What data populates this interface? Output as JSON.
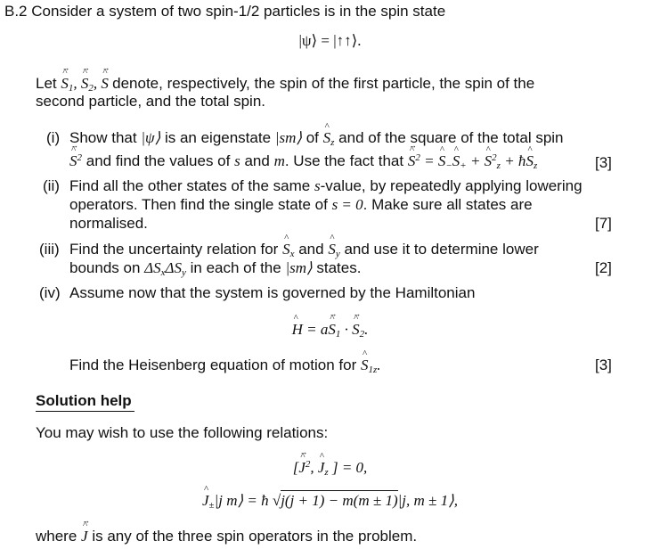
{
  "question": {
    "number": "B.2",
    "intro": "Consider a system of two spin-1/2 particles is in the spin state",
    "state_eq": "|ψ⟩ = |↑↑⟩.",
    "let_prefix": "Let",
    "let_ops": "S₁, S₂, S",
    "let_line1": "denote, respectively, the spin of the first particle, the spin of the",
    "let_line2": "second particle, and the total spin."
  },
  "parts": [
    {
      "label": "(i)",
      "line1_a": "Show that",
      "line1_psi": "|ψ⟩",
      "line1_b": "is an eigenstate",
      "line1_sm": "|sm⟩",
      "line1_c": "of",
      "line1_d": "and of the square of the total spin",
      "line2_a": "and find the values of",
      "line2_s": "s",
      "line2_and": "and",
      "line2_m": "m",
      "line2_b": ". Use the fact that",
      "line2_eq": "= S₋S₊ + S²_z + ħS_z",
      "marks": "[3]"
    },
    {
      "label": "(ii)",
      "line1_a": "Find all the other states of the same",
      "line1_s": "s",
      "line1_b": "-value, by repeatedly applying lowering",
      "line2_a": "operators.  Then find the single state of",
      "line2_eq": "s = 0",
      "line2_b": ".  Make sure all states are",
      "line3": "normalised.",
      "marks": "[7]"
    },
    {
      "label": "(iii)",
      "line1_a": "Find the uncertainty relation for",
      "line1_and": "and",
      "line1_b": "and use it to determine lower",
      "line2_a": "bounds on",
      "line2_eq": "ΔS_xΔS_y",
      "line2_b": "in each of the",
      "line2_sm": "|sm⟩",
      "line2_c": "states.",
      "marks": "[2]"
    },
    {
      "label": "(iv)",
      "line1": "Assume now that the system is governed by the Hamiltonian",
      "hamiltonian": "H = a S₁ · S₂.",
      "line2": "Find the Heisenberg equation of motion for",
      "line2_op": "S₁z.",
      "marks": "[3]"
    }
  ],
  "solution": {
    "heading": "Solution help",
    "intro": "You may wish to use the following relations:",
    "relation1": "[J², J_z] = 0,",
    "relation2_lhs": "J±|jm⟩ = ħ",
    "relation2_sqrt": "j(j + 1) − m(m ± 1)",
    "relation2_rhs": "|j, m ± 1⟩,",
    "footer_a": "where",
    "footer_b": "is any of the three spin operators in the problem."
  }
}
